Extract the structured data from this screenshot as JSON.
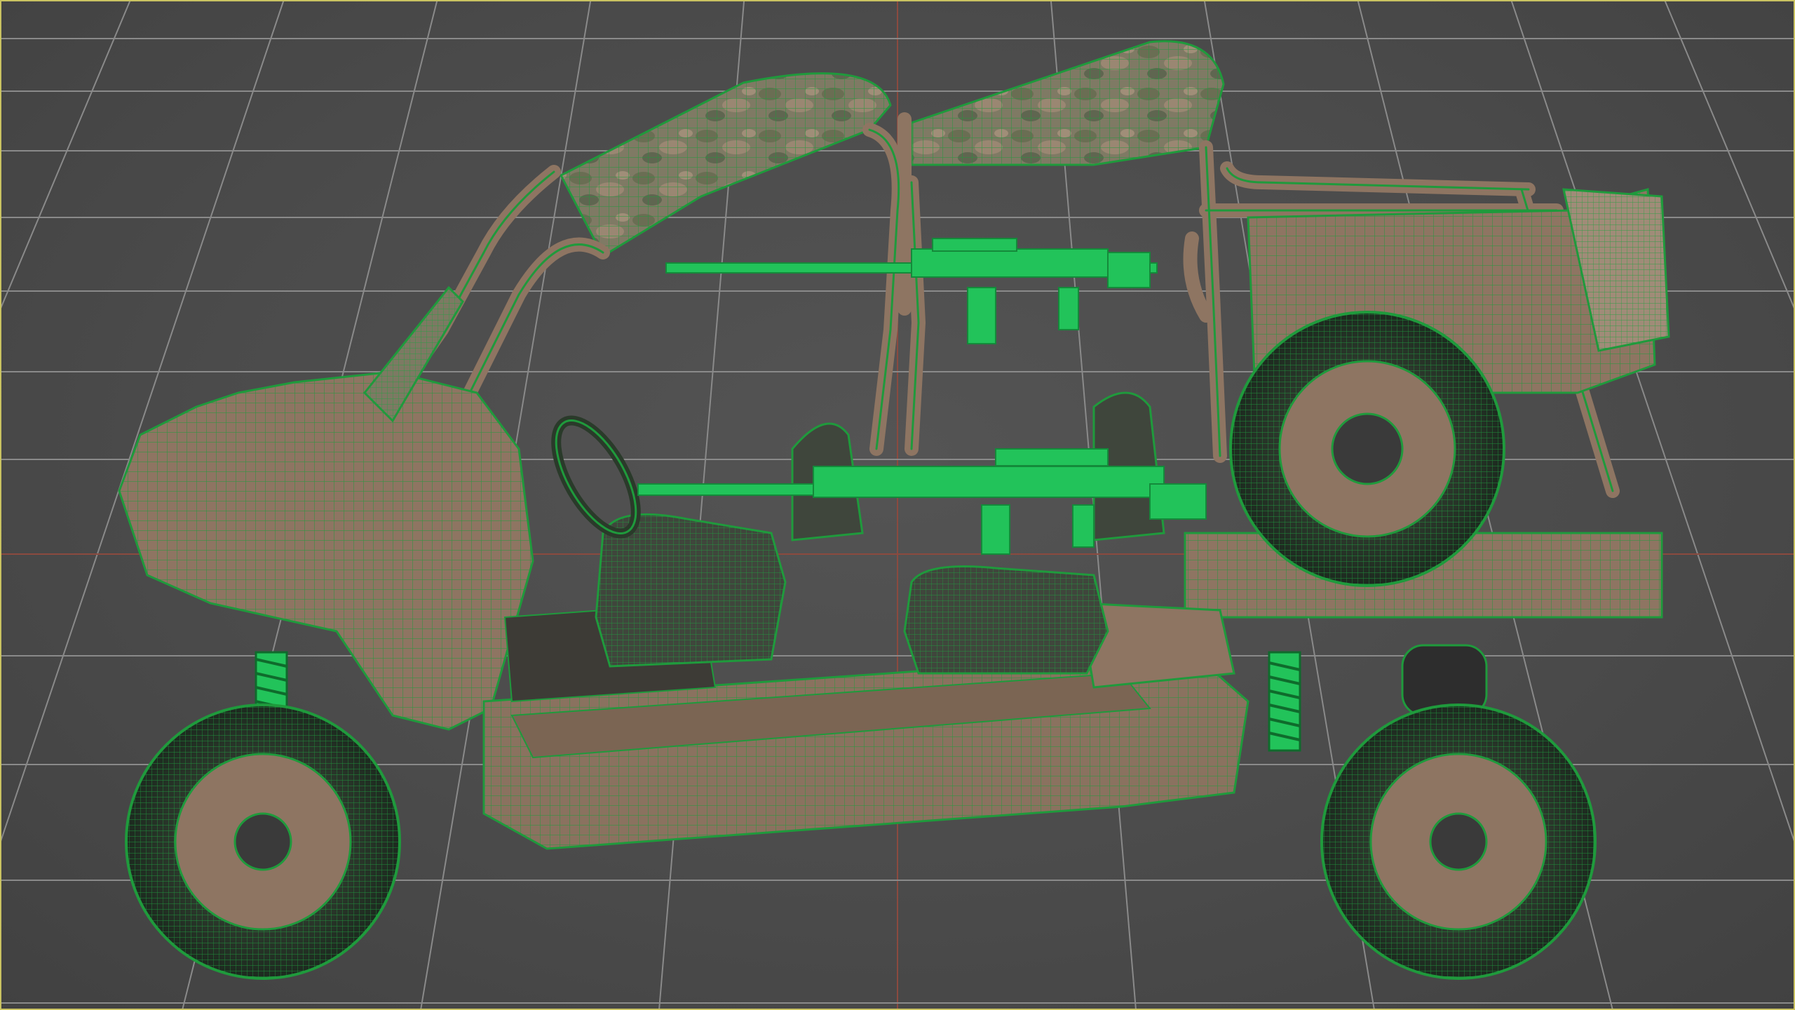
{
  "viewport": {
    "view": "side-orthographic",
    "display_mode": "shaded-with-wireframe",
    "background_color": "#4b4b4b",
    "grid_color": "#8a8a8a",
    "axis_x_color": "#8b4a3f",
    "frame_color": "#c9c261",
    "wireframe_color": "#1f9a3c",
    "body_color": "#8e7562",
    "camo_colors": [
      "#7d7a63",
      "#8a7a68",
      "#6b7055",
      "#9a8571"
    ],
    "highlight_color": "#22c35a"
  },
  "model": {
    "parts": [
      "front-wheel",
      "rear-wheel",
      "spare-wheel",
      "roll-cage",
      "camo-roof",
      "rifle-upper",
      "rifle-lower",
      "front-seat",
      "rear-seat",
      "cargo-rack",
      "front-suspension",
      "rear-suspension",
      "windshield",
      "steering-wheel",
      "chassis-body"
    ]
  }
}
